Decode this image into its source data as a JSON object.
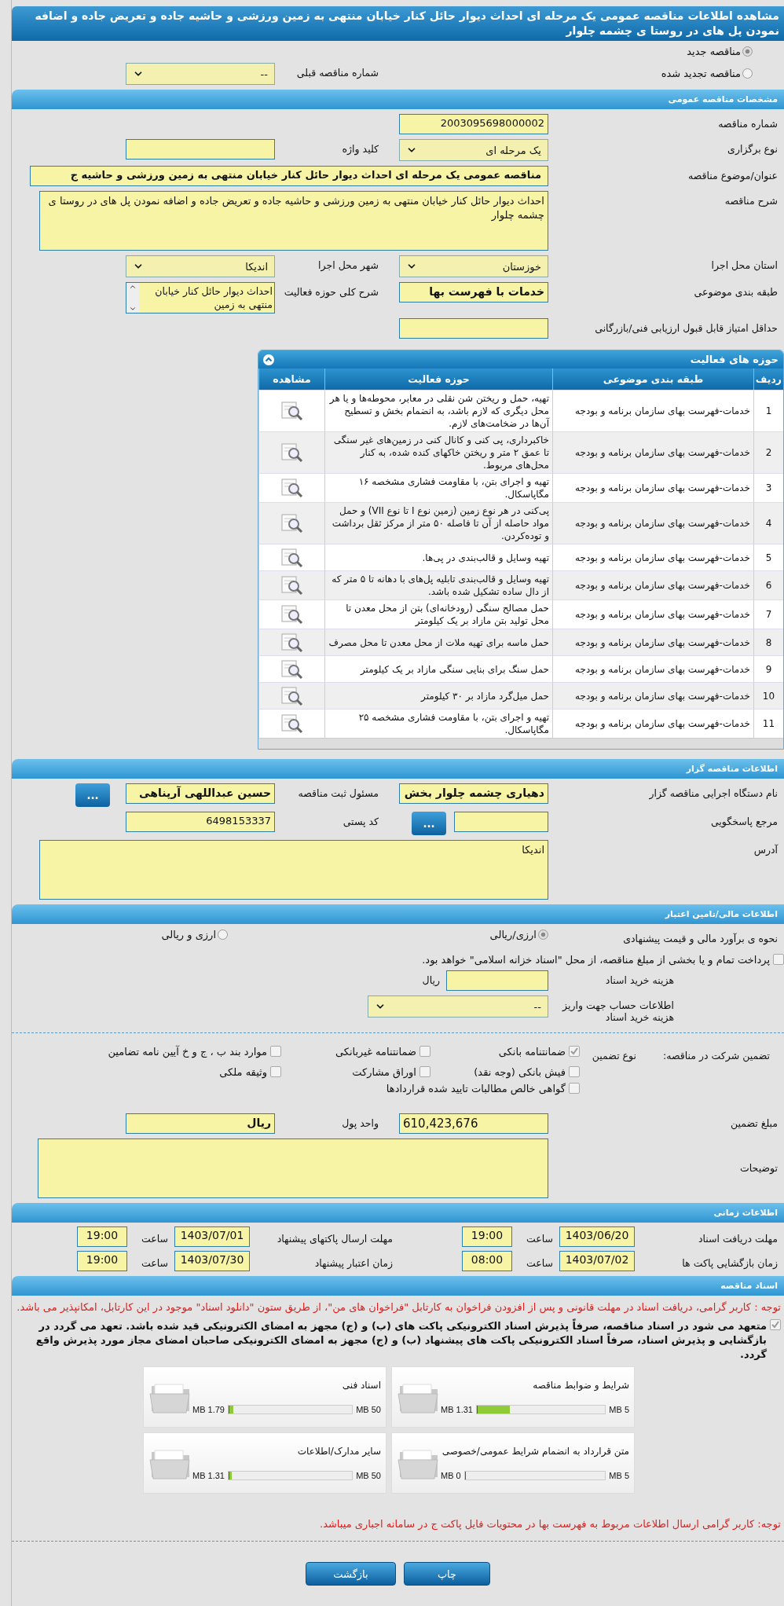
{
  "title": "مشاهده اطلاعات مناقصه عمومی یک مرحله ای احداث دیوار حائل کنار خیابان منتهی به زمین ورزشی و حاشیه جاده و تعریض جاده و اضافه نمودن پل های در روستا ی چشمه چلوار",
  "tender_type": [
    {
      "label": "مناقصه جدید",
      "selected": true
    },
    {
      "label": "مناقصه تجدید شده",
      "selected": false
    }
  ],
  "previous_tender": {
    "label": "شماره مناقصه قبلی",
    "value": "--"
  },
  "general": {
    "title": "مشخصات مناقصه عمومی",
    "rows": [
      [
        {
          "label": "شماره مناقصه",
          "kind": "text",
          "value": "2003095698000002"
        }
      ],
      [
        {
          "label": "نوع برگزاری",
          "kind": "select",
          "value": "یک مرحله ای"
        },
        {
          "label": "کلید واژه",
          "kind": "text"
        }
      ],
      [
        {
          "label": "عنوان/موضوع مناقصه",
          "kind": "wide",
          "value": "مناقصه عمومی یک مرحله ای احداث دیوار حائل کنار خیابان منتهی به زمین ورزشی و حاشیه ج",
          "bold": true
        }
      ],
      [
        {
          "label": "شرح مناقصه",
          "kind": "textarea",
          "value": "احداث دیوار حائل کنار خیابان منتهی به زمین ورزشی و حاشیه جاده و تعریض جاده و اضافه نمودن پل های در روستا ی چشمه چلوار"
        }
      ],
      [
        {
          "label": "استان محل اجرا",
          "kind": "select",
          "value": "خوزستان"
        },
        {
          "label": "شهر محل اجرا",
          "kind": "select",
          "value": "اندیکا"
        }
      ],
      [
        {
          "label": "طبقه بندی موضوعی",
          "kind": "text",
          "value": "خدمات با فهرست بها",
          "bold": true
        },
        {
          "label": "شرح کلی حوزه فعالیت",
          "kind": "listbox",
          "value": "احداث دیوار حائل کنار خیابان منتهی به زمین"
        }
      ],
      [
        {
          "label": "حداقل امتیاز قابل قبول ارزیابی فنی/بازرگانی",
          "kind": "text"
        }
      ]
    ]
  },
  "activities": {
    "title": "حوزه های فعالیت",
    "columns": [
      "ردیف",
      "طبقه بندی موضوعی",
      "حوزه فعالیت",
      "مشاهده"
    ],
    "rows": [
      {
        "index": "1",
        "category": "خدمات-فهرست بهای سازمان برنامه و بودجه",
        "activity": "تهیه، حمل و ریختن شن نقلی در معابر، محوطه‌ها و یا هر محل دیگری که لازم باشد، به انضمام بخش و تسطیح آن‌ها در ضخامت‌های لازم."
      },
      {
        "index": "2",
        "category": "خدمات-فهرست بهای سازمان برنامه و بودجه",
        "activity": "خاکبرداری، پی کنی و کانال کنی در زمین‌های غیر سنگی تا عمق ۲ متر و ریختن خاکهای کنده شده، به کنار محل‌های مربوط."
      },
      {
        "index": "3",
        "category": "خدمات-فهرست بهای سازمان برنامه و بودجه",
        "activity": "تهیه و اجرای بتن، با مقاومت فشاری مشخصه ۱۶ مگاپاسکال."
      },
      {
        "index": "4",
        "category": "خدمات-فهرست بهای سازمان برنامه و بودجه",
        "activity": "پی‌کنی در هر نوع زمین (زمین نوع I تا نوع VII) و حمل مواد حاصله از آن تا فاصله ۵۰ متر از مرکز ثقل برداشت و توده‌کردن."
      },
      {
        "index": "5",
        "category": "خدمات-فهرست بهای سازمان برنامه و بودجه",
        "activity": "تهیه وسایل و قالب‌بندی در پی‌ها."
      },
      {
        "index": "6",
        "category": "خدمات-فهرست بهای سازمان برنامه و بودجه",
        "activity": "تهیه وسایل و قالب‌بندی تابلیه پل‌های با دهانه تا ۵ متر که از دال ساده تشکیل شده باشد."
      },
      {
        "index": "7",
        "category": "خدمات-فهرست بهای سازمان برنامه و بودجه",
        "activity": "حمل مصالح سنگی (رودخانه‌ای) بتن از محل معدن تا محل تولید بتن مازاد بر یک کیلومتر"
      },
      {
        "index": "8",
        "category": "خدمات-فهرست بهای سازمان برنامه و بودجه",
        "activity": "حمل ماسه برای تهیه ملات از محل معدن تا محل مصرف"
      },
      {
        "index": "9",
        "category": "خدمات-فهرست بهای سازمان برنامه و بودجه",
        "activity": "حمل سنگ برای بنایی سنگی مازاد بر یک کیلومتر"
      },
      {
        "index": "10",
        "category": "خدمات-فهرست بهای سازمان برنامه و بودجه",
        "activity": "حمل میل‌گرد مازاد بر ۳۰ کیلومتر"
      },
      {
        "index": "11",
        "category": "خدمات-فهرست بهای سازمان برنامه و بودجه",
        "activity": "تهیه و اجرای بتن، با مقاومت فشاری مشخصه ۲۵ مگاپاسکال."
      }
    ]
  },
  "organizer": {
    "title": "اطلاعات مناقصه گزار",
    "rows": [
      [
        {
          "label": "نام دستگاه اجرایی مناقصه گزار",
          "kind": "text",
          "value": "دهیاری چشمه چلوار بخش",
          "bold": true
        },
        {
          "label": "مسئول ثبت مناقصه",
          "kind": "lookup",
          "value": "حسین عبداللهی آرپناهی",
          "bold": true,
          "button": "..."
        }
      ],
      [
        {
          "label": "مرجع پاسخگویی",
          "kind": "lookup",
          "button": "..."
        },
        {
          "label": "کد پستی",
          "kind": "text",
          "value": "6498153337"
        }
      ],
      [
        {
          "label": "آدرس",
          "kind": "textarea",
          "value": "اندیکا"
        }
      ]
    ]
  },
  "financial": {
    "title": "اطلاعات مالی/تامین اعتبار",
    "estimate": {
      "label": "نحوه ی برآورد مالی و قیمت پیشنهادی",
      "options": [
        {
          "label": "ارزی/ریالی",
          "selected": true
        },
        {
          "label": "ارزی و ریالی",
          "selected": false
        }
      ]
    },
    "treasury": {
      "checked": false,
      "text": "پرداخت تمام و یا بخشی از مبلغ مناقصه، از محل \"اسناد خزانه اسلامی\" خواهد بود."
    },
    "doc_fee": {
      "label": "هزینه خرید اسناد",
      "unit": "ریال"
    },
    "account": {
      "label": "اطلاعات حساب جهت واریز هزینه خرید اسناد",
      "value": "--"
    }
  },
  "guarantee": {
    "label": "تضمین شرکت در مناقصه:",
    "type_label": "نوع تضمین",
    "options": [
      {
        "label": "ضمانتنامه بانکی",
        "checked": true
      },
      {
        "label": "ضمانتنامه غیربانکی",
        "checked": false
      },
      {
        "label": "موارد بند ب ، ج و خ آیین نامه تضامین",
        "checked": false
      },
      {
        "label": "فیش بانکی (وجه نقد)",
        "checked": false
      },
      {
        "label": "اوراق مشارکت",
        "checked": false
      },
      {
        "label": "وثیقه ملکی",
        "checked": false
      },
      {
        "label": "گواهی خالص مطالبات تایید شده قراردادها",
        "checked": false
      }
    ],
    "amount": {
      "label": "مبلغ تضمین",
      "value": "610,423,676"
    },
    "currency": {
      "label": "واحد پول",
      "value": "ریال"
    },
    "notes": {
      "label": "توضیحات"
    }
  },
  "timing": {
    "title": "اطلاعات زمانی",
    "rows": [
      [
        {
          "label": "مهلت دریافت اسناد",
          "date": "1403/06/20",
          "time_label": "ساعت",
          "time": "19:00"
        },
        {
          "label": "مهلت ارسال پاکتهای پیشنهاد",
          "date": "1403/07/01",
          "time_label": "ساعت",
          "time": "19:00"
        }
      ],
      [
        {
          "label": "زمان بازگشایی پاکت ها",
          "date": "1403/07/02",
          "time_label": "ساعت",
          "time": "08:00"
        },
        {
          "label": "زمان اعتبار پیشنهاد",
          "date": "1403/07/30",
          "time_label": "ساعت",
          "time": "19:00"
        }
      ]
    ]
  },
  "documents": {
    "title": "اسناد مناقصه",
    "notice": "توجه : کاربر گرامی، دریافت اسناد در مهلت قانونی و پس از افزودن فراخوان به کارتابل \"فراخوان های من\"، از طریق ستون \"دانلود اسناد\" موجود در این کارتابل، امکانپذیر می باشد.",
    "pledge": {
      "checked": true,
      "text": "متعهد می شود در اسناد مناقصه، صرفاً پذیرش اسناد الکترونیکی پاکت های (ب) و (ج) مجهز به امضای الکترونیکی قید شده باشد. تعهد می گردد در بازگشایی و پذیرش اسناد، صرفاً اسناد الکترونیکی پاکت های پیشنهاد (ب) و (ج) مجهز به امضای الکترونیکی صاحبان امضای مجاز مورد پذیرش واقع گردد."
    },
    "files": [
      {
        "name": "شرایط و ضوابط مناقصه",
        "size": "1.31 MB",
        "max": "5 MB",
        "level": 0.26
      },
      {
        "name": "اسناد فنی",
        "size": "1.79 MB",
        "max": "50 MB",
        "level": 0.036
      },
      {
        "name": "متن قرارداد به انضمام شرایط عمومی/خصوصی",
        "size": "0 MB",
        "max": "5 MB",
        "level": 0
      },
      {
        "name": "سایر مدارک/اطلاعات",
        "size": "1.31 MB",
        "max": "50 MB",
        "level": 0.026
      }
    ],
    "footer_notice": "توجه: کاربر گرامی ارسال اطلاعات مربوط به فهرست بها در محتویات فایل پاکت ج در سامانه اجباری میباشد."
  },
  "buttons": [
    "چاپ",
    "بازگشت"
  ]
}
